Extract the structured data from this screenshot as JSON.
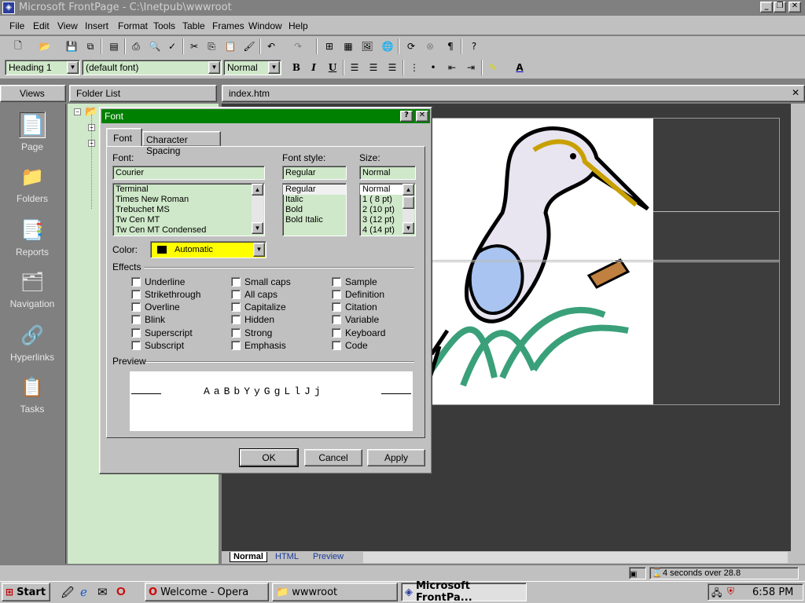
{
  "window": {
    "title": "Microsoft FrontPage - C:\\Inetpub\\wwwroot"
  },
  "menu": [
    "File",
    "Edit",
    "View",
    "Insert",
    "Format",
    "Tools",
    "Table",
    "Frames",
    "Window",
    "Help"
  ],
  "format_bar": {
    "style": "Heading 1",
    "font": "(default font)",
    "size": "Normal"
  },
  "panes": {
    "views": "Views",
    "folder_list": "Folder List",
    "doc_tab": "index.htm"
  },
  "views": [
    "Page",
    "Folders",
    "Reports",
    "Navigation",
    "Hyperlinks",
    "Tasks"
  ],
  "font_dialog": {
    "title": "Font",
    "tabs": [
      "Font",
      "Character Spacing"
    ],
    "font_label": "Font:",
    "font_value": "Courier",
    "font_list": [
      "Terminal",
      "Times New Roman",
      "Trebuchet MS",
      "Tw Cen MT",
      "Tw Cen MT Condensed"
    ],
    "style_label": "Font style:",
    "style_value": "Regular",
    "style_list": [
      "Regular",
      "Italic",
      "Bold",
      "Bold Italic"
    ],
    "size_label": "Size:",
    "size_value": "Normal",
    "size_list": [
      "Normal",
      "1  ( 8 pt)",
      "2  (10 pt)",
      "3  (12 pt)",
      "4  (14 pt)"
    ],
    "color_label": "Color:",
    "color_value": "Automatic",
    "effects_label": "Effects",
    "effects_col1": [
      "Underline",
      "Strikethrough",
      "Overline",
      "Blink",
      "Superscript",
      "Subscript"
    ],
    "effects_col2": [
      "Small caps",
      "All caps",
      "Capitalize",
      "Hidden",
      "Strong",
      "Emphasis"
    ],
    "effects_col3": [
      "Sample",
      "Definition",
      "Citation",
      "Variable",
      "Keyboard",
      "Code"
    ],
    "preview_label": "Preview",
    "preview_text": "AaBbYyGgLlJj",
    "ok": "OK",
    "cancel": "Cancel",
    "apply": "Apply"
  },
  "bottom_tabs": [
    "Normal",
    "HTML",
    "Preview"
  ],
  "status": {
    "download": "4 seconds over 28.8"
  },
  "taskbar": {
    "start": "Start",
    "tasks": [
      "Welcome - Opera",
      "wwwroot",
      "Microsoft FrontPa..."
    ],
    "clock": "6:58 PM"
  },
  "colors": {
    "title_active": "#008000",
    "field_bg": "#cfe8c9",
    "page_bg": "#3a3a3a"
  }
}
